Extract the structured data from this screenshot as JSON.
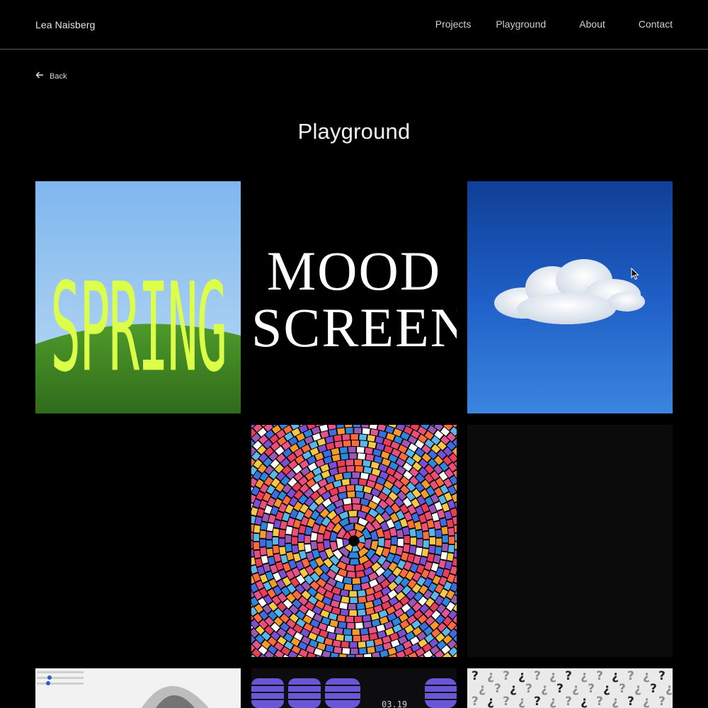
{
  "header": {
    "logo": "Lea Naisberg",
    "nav": [
      "Projects",
      "Playground",
      "About",
      "Contact"
    ]
  },
  "back_label": "Back",
  "page_title": "Playground",
  "tiles": {
    "spring_text": "SPRING",
    "mood_line1": "MOOD",
    "mood_line2": "SCREEN",
    "date_text": "03.19"
  },
  "colors": {
    "background": "#000000",
    "spring_type": "#dcff4a",
    "sky_blue": "#1c5fc7"
  },
  "icons": [
    "arrow-left-icon",
    "cursor-icon"
  ]
}
